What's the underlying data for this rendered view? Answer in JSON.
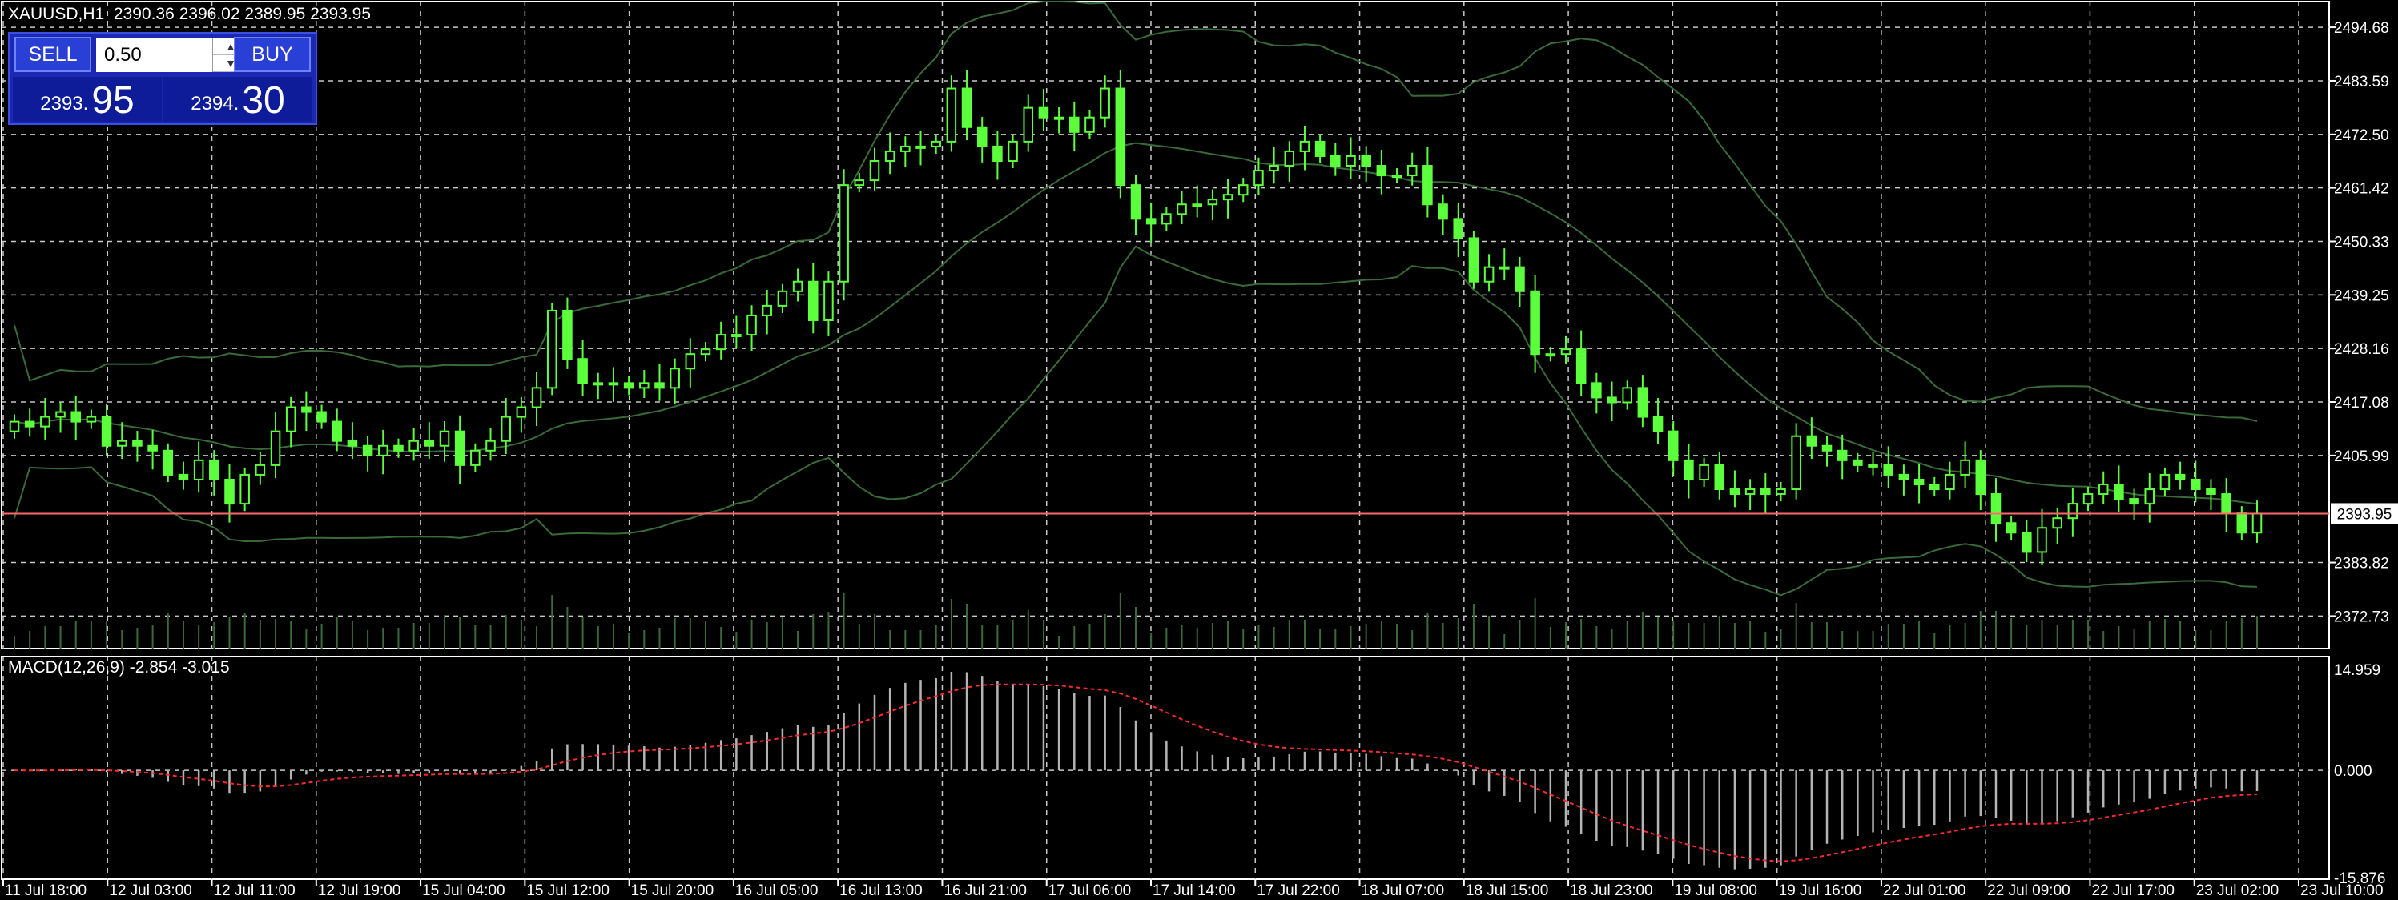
{
  "header": {
    "symbol": "XAUUSD,H1",
    "ohlc": "2390.36 2396.02 2389.95 2393.95"
  },
  "trade_panel": {
    "sell_label": "SELL",
    "buy_label": "BUY",
    "lot_value": "0.50",
    "bid_prefix": "2393.",
    "bid_big": "95",
    "ask_prefix": "2394.",
    "ask_big": "30"
  },
  "macd_title": "MACD(12,26,9) -2.854 -3.015",
  "colors": {
    "background": "#000000",
    "grid": "#c8c8c8",
    "candle": "#5cff3c",
    "bands": "#3a6a3a",
    "bid_line": "#ff6a6a",
    "macd_hist": "#b4b4b4",
    "macd_signal": "#ff2a2a",
    "axis_text": "#ffffff",
    "panel": "#1a28b4"
  },
  "chart_data": [
    {
      "type": "candlestick",
      "title": "XAUUSD,H1",
      "ylim": [
        2366,
        2500
      ],
      "y_ticks": [
        2494.68,
        2483.59,
        2472.5,
        2461.42,
        2450.33,
        2439.25,
        2428.16,
        2417.08,
        2405.99,
        2383.82,
        2372.73
      ],
      "current_price_label": "2393.95",
      "x_ticks": [
        "11 Jul 18:00",
        "12 Jul 03:00",
        "12 Jul 11:00",
        "12 Jul 19:00",
        "15 Jul 04:00",
        "15 Jul 12:00",
        "15 Jul 20:00",
        "16 Jul 05:00",
        "16 Jul 13:00",
        "16 Jul 21:00",
        "17 Jul 06:00",
        "17 Jul 14:00",
        "17 Jul 22:00",
        "18 Jul 07:00",
        "18 Jul 15:00",
        "18 Jul 23:00",
        "19 Jul 08:00",
        "19 Jul 16:00",
        "22 Jul 01:00",
        "22 Jul 09:00",
        "22 Jul 17:00",
        "23 Jul 02:00",
        "23 Jul 10:00"
      ],
      "close": [
        2413,
        2412,
        2414,
        2415,
        2413,
        2414,
        2408,
        2409,
        2408,
        2407,
        2402,
        2401,
        2405,
        2401,
        2396,
        2402,
        2404,
        2411,
        2416,
        2415,
        2413,
        2409,
        2408,
        2406,
        2408,
        2407,
        2409,
        2408,
        2411,
        2404,
        2407,
        2409,
        2414,
        2416,
        2420,
        2436,
        2426,
        2421,
        2421,
        2421,
        2420,
        2421,
        2420,
        2424,
        2427,
        2428,
        2431,
        2431,
        2435,
        2437,
        2440,
        2442,
        2434,
        2442,
        2462,
        2463,
        2467,
        2469,
        2470,
        2470,
        2471,
        2482,
        2474,
        2470,
        2467,
        2471,
        2478,
        2476,
        2476,
        2473,
        2476,
        2482,
        2462,
        2455,
        2454,
        2456,
        2458,
        2458,
        2459,
        2460,
        2462,
        2465,
        2466,
        2469,
        2471,
        2468,
        2466,
        2468,
        2466,
        2464,
        2464,
        2466,
        2458,
        2455,
        2451,
        2442,
        2445,
        2445,
        2440,
        2427,
        2427,
        2428,
        2421,
        2418,
        2417,
        2420,
        2414,
        2411,
        2405,
        2401,
        2404,
        2399,
        2398,
        2399,
        2398,
        2399,
        2410,
        2408,
        2407,
        2405,
        2404,
        2404,
        2402,
        2401,
        2400,
        2399,
        2402,
        2405,
        2398,
        2392,
        2390,
        2386,
        2391,
        2393,
        2396,
        2398,
        2400,
        2397,
        2396,
        2399,
        2402,
        2401,
        2399,
        2398,
        2394,
        2390,
        2393.95
      ],
      "volume_note": "volume bars shown at bottom of price panel"
    },
    {
      "type": "histogram_line",
      "title": "MACD(12,26,9) -2.854 -3.015",
      "ylim": [
        -15.876,
        14.959
      ],
      "y_ticks": [
        14.959,
        0.0,
        -15.876
      ],
      "macd_main": -2.854,
      "signal": -3.015
    }
  ]
}
